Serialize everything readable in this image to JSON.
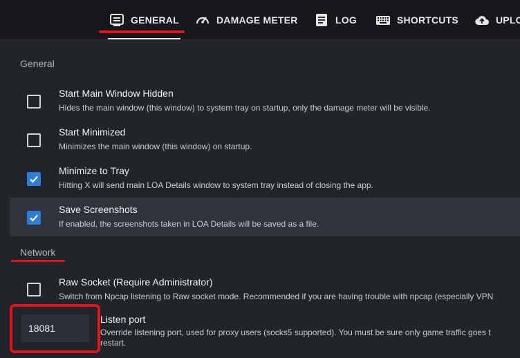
{
  "tabs": [
    {
      "label": "GENERAL",
      "icon": "general-settings-icon",
      "active": true
    },
    {
      "label": "DAMAGE METER",
      "icon": "speedometer-icon",
      "active": false
    },
    {
      "label": "LOG",
      "icon": "document-icon",
      "active": false
    },
    {
      "label": "SHORTCUTS",
      "icon": "keyboard-icon",
      "active": false
    },
    {
      "label": "UPLO",
      "icon": "cloud-upload-icon",
      "active": false
    }
  ],
  "sections": {
    "general": "General",
    "network": "Network"
  },
  "general_settings": [
    {
      "label": "Start Main Window Hidden",
      "desc": "Hides the main window (this window) to system tray on startup, only the damage meter will be visible.",
      "checked": false
    },
    {
      "label": "Start Minimized",
      "desc": "Minimizes the main window (this window) on startup.",
      "checked": false
    },
    {
      "label": "Minimize to Tray",
      "desc": "Hitting X will send main LOA Details window to system tray instead of closing the app.",
      "checked": true
    },
    {
      "label": "Save Screenshots",
      "desc": "If enabled, the screenshots taken in LOA Details will be saved as a file.",
      "checked": true
    }
  ],
  "network_settings": {
    "raw_socket": {
      "label": "Raw Socket (Require Administrator)",
      "desc": "Switch from Npcap listening to Raw socket mode. Recommended if you are having trouble with npcap (especially VPN",
      "checked": false
    },
    "listen_port": {
      "value": "18081",
      "label": "Listen port",
      "desc_line1": "Override listening port, used for proxy users (socks5 supported). You must be sure only game traffic goes t",
      "desc_line2": "restart."
    }
  },
  "colors": {
    "accent": "#2c7fd8",
    "annotation_red": "#e0141c",
    "background": "#212429"
  }
}
